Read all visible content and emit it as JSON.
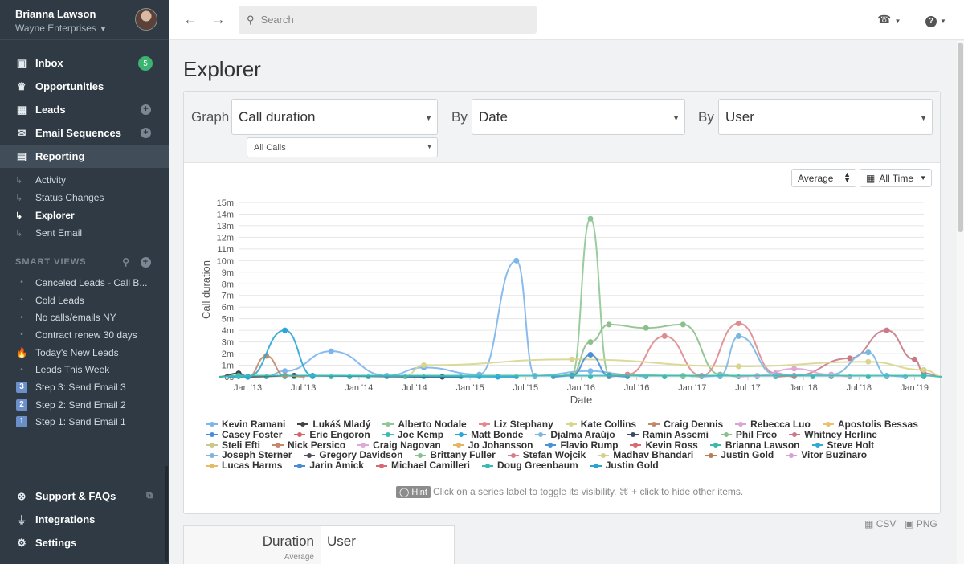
{
  "user": {
    "name": "Brianna Lawson",
    "org": "Wayne Enterprises"
  },
  "nav": [
    {
      "label": "Inbox",
      "icon": "inbox-icon",
      "badge": "5"
    },
    {
      "label": "Opportunities",
      "icon": "trophy-icon"
    },
    {
      "label": "Leads",
      "icon": "building-icon",
      "plus": true
    },
    {
      "label": "Email Sequences",
      "icon": "envelope-icon",
      "plus": true
    },
    {
      "label": "Reporting",
      "icon": "chart-icon",
      "active": true
    }
  ],
  "reporting_sub": [
    "Activity",
    "Status Changes",
    "Explorer",
    "Sent Email"
  ],
  "smart_views": {
    "title": "SMART VIEWS",
    "items": [
      {
        "label": "Canceled Leads - Call B...",
        "mark": "dot"
      },
      {
        "label": "Cold Leads",
        "mark": "dot"
      },
      {
        "label": "No calls/emails NY",
        "mark": "dot"
      },
      {
        "label": "Contract renew 30 days",
        "mark": "dot"
      },
      {
        "label": "Today's New Leads",
        "mark": "fire"
      },
      {
        "label": "Leads This Week",
        "mark": "dot"
      },
      {
        "label": "Step 3: Send Email 3",
        "mark": "3"
      },
      {
        "label": "Step 2: Send Email 2",
        "mark": "2"
      },
      {
        "label": "Step 1: Send Email 1",
        "mark": "1"
      }
    ]
  },
  "bottom_nav": [
    {
      "label": "Support & FAQs",
      "icon": "lifebuoy-icon"
    },
    {
      "label": "Integrations",
      "icon": "plug-icon"
    },
    {
      "label": "Settings",
      "icon": "gear-icon"
    }
  ],
  "search": {
    "placeholder": "Search"
  },
  "page": {
    "title": "Explorer"
  },
  "controls": {
    "graph_label": "Graph",
    "graph_value": "Call duration",
    "filter_value": "All Calls",
    "by1_label": "By",
    "by1_value": "Date",
    "by2_label": "By",
    "by2_value": "User",
    "aggregate": "Average",
    "range": "All Time"
  },
  "hint": {
    "tag": "Hint",
    "text": "Click on a series label to toggle its visibility. ⌘ + click to hide other items."
  },
  "exports": {
    "csv": "CSV",
    "png": "PNG"
  },
  "table": {
    "col1": "Duration",
    "col1_sub": "Average",
    "col2": "User"
  },
  "chart_data": {
    "type": "line",
    "xlabel": "Date",
    "ylabel": "Call duration",
    "y_ticks": [
      "0s",
      "1m",
      "2m",
      "3m",
      "4m",
      "5m",
      "6m",
      "7m",
      "8m",
      "9m",
      "10m",
      "11m",
      "12m",
      "13m",
      "14m",
      "15m"
    ],
    "ylim": [
      0,
      15
    ],
    "y_unit": "minutes",
    "x_ticks": [
      "Jan '13",
      "Jul '13",
      "Jan '14",
      "Jul '14",
      "Jan '15",
      "Jul '15",
      "Jan '16",
      "Jul '16",
      "Jan '17",
      "Jul '17",
      "Jan '18",
      "Jul '18",
      "Jan '19"
    ],
    "x": [
      "2012-12",
      "2013-01",
      "2013-03",
      "2013-05",
      "2013-06",
      "2013-08",
      "2013-10",
      "2013-12",
      "2014-02",
      "2014-04",
      "2014-06",
      "2014-08",
      "2014-10",
      "2014-12",
      "2015-02",
      "2015-04",
      "2015-06",
      "2015-08",
      "2015-10",
      "2015-12",
      "2016-02",
      "2016-04",
      "2016-06",
      "2016-08",
      "2016-10",
      "2016-12",
      "2017-02",
      "2017-04",
      "2017-06",
      "2017-08",
      "2017-10",
      "2017-12",
      "2018-02",
      "2018-04",
      "2018-06",
      "2018-08",
      "2018-10",
      "2018-12",
      "2019-02"
    ],
    "series": [
      {
        "name": "Kevin Ramani",
        "color": "#7cb5ec"
      },
      {
        "name": "Lukáš Mladý",
        "color": "#434348"
      },
      {
        "name": "Alberto Nodale",
        "color": "#90c695"
      },
      {
        "name": "Liz Stephany",
        "color": "#e08a8f"
      },
      {
        "name": "Kate Collins",
        "color": "#d9d58d"
      },
      {
        "name": "Craig Dennis",
        "color": "#c08a68"
      },
      {
        "name": "Rebecca Luo",
        "color": "#d9a3d6"
      },
      {
        "name": "Apostolis Bessas",
        "color": "#e8c16a"
      },
      {
        "name": "Casey Foster",
        "color": "#4a8ed6"
      },
      {
        "name": "Eric Engoron",
        "color": "#d6646a"
      },
      {
        "name": "Joe Kemp",
        "color": "#3cbcb4"
      },
      {
        "name": "Matt Bonde",
        "color": "#2ca6d8"
      },
      {
        "name": "Djalma Araújo",
        "color": "#7ab7e3"
      },
      {
        "name": "Ramin Assemi",
        "color": "#3f4a5e"
      },
      {
        "name": "Phil Freo",
        "color": "#8cc08a"
      },
      {
        "name": "Whitney Herline",
        "color": "#c97a86"
      },
      {
        "name": "Steli Efti",
        "color": "#c9c98a"
      },
      {
        "name": "Nick Persico",
        "color": "#c7876a"
      },
      {
        "name": "Craig Nagovan",
        "color": "#e0a8d8"
      },
      {
        "name": "Jo Johansson",
        "color": "#e5b563"
      },
      {
        "name": "Flavio Rump",
        "color": "#4b93d9"
      },
      {
        "name": "Kevin Ross",
        "color": "#d96a72"
      },
      {
        "name": "Brianna Lawson",
        "color": "#3cb8ad"
      },
      {
        "name": "Steve Holt",
        "color": "#33a9d6"
      },
      {
        "name": "Joseph Sterner",
        "color": "#82b3e0"
      },
      {
        "name": "Gregory Davidson",
        "color": "#4b4f5c"
      },
      {
        "name": "Brittany Fuller",
        "color": "#86c08a"
      },
      {
        "name": "Stefan Wojcik",
        "color": "#d48088"
      },
      {
        "name": "Madhav Bhandari",
        "color": "#d4d08c"
      },
      {
        "name": "Justin Gold",
        "color": "#b87c58"
      },
      {
        "name": "Vitor Buzinaro",
        "color": "#d9a0d6"
      },
      {
        "name": "Lucas Harms",
        "color": "#e5bc66"
      },
      {
        "name": "Jarin Amick",
        "color": "#4a8bd4"
      },
      {
        "name": "Michael Camilleri",
        "color": "#d66a72"
      },
      {
        "name": "Doug Greenbaum",
        "color": "#3bbab0"
      },
      {
        "name": "Justin Gold",
        "color": "#2aa4d6"
      }
    ],
    "plotted": [
      {
        "name": "Kevin Ramani",
        "color": "#7cb5ec",
        "points": [
          [
            "2013-05",
            0.5
          ],
          [
            "2013-10",
            2.2
          ],
          [
            "2014-04",
            0.1
          ],
          [
            "2014-08",
            0.8
          ],
          [
            "2015-02",
            0.2
          ],
          [
            "2015-06",
            10.0
          ],
          [
            "2015-08",
            0.1
          ],
          [
            "2016-02",
            0.5
          ],
          [
            "2016-06",
            0.2
          ]
        ]
      },
      {
        "name": "Lukáš Mladý",
        "color": "#434348",
        "points": [
          [
            "2012-12",
            0.3
          ],
          [
            "2013-01",
            0.0
          ],
          [
            "2013-06",
            0.1
          ],
          [
            "2014-10",
            0.0
          ]
        ]
      },
      {
        "name": "Alberto Nodale",
        "color": "#90c695",
        "points": [
          [
            "2015-12",
            0.2
          ],
          [
            "2016-02",
            13.6
          ],
          [
            "2016-04",
            0.2
          ],
          [
            "2016-12",
            0.1
          ]
        ]
      },
      {
        "name": "Phil Freo",
        "color": "#8cc08a",
        "points": [
          [
            "2016-02",
            3.0
          ],
          [
            "2016-04",
            4.5
          ],
          [
            "2016-08",
            4.2
          ],
          [
            "2016-12",
            4.5
          ],
          [
            "2017-04",
            0.2
          ]
        ]
      },
      {
        "name": "Liz Stephany",
        "color": "#e08a8f",
        "points": [
          [
            "2016-06",
            0.2
          ],
          [
            "2016-10",
            3.5
          ],
          [
            "2017-02",
            0.1
          ],
          [
            "2017-06",
            4.6
          ],
          [
            "2017-10",
            0.3
          ]
        ]
      },
      {
        "name": "Whitney Herline",
        "color": "#c97a86",
        "points": [
          [
            "2017-12",
            0.1
          ],
          [
            "2018-06",
            1.6
          ],
          [
            "2018-10",
            4.0
          ],
          [
            "2019-01",
            1.5
          ],
          [
            "2019-02",
            0.3
          ]
        ]
      },
      {
        "name": "Kate Collins",
        "color": "#d9d58d",
        "points": [
          [
            "2014-08",
            1.0
          ],
          [
            "2015-12",
            1.5
          ],
          [
            "2017-06",
            0.9
          ],
          [
            "2018-08",
            1.3
          ],
          [
            "2019-02",
            0.6
          ]
        ]
      },
      {
        "name": "Craig Dennis",
        "color": "#c08a68",
        "points": [
          [
            "2013-01",
            0.0
          ],
          [
            "2013-03",
            1.8
          ],
          [
            "2013-05",
            0.1
          ]
        ]
      },
      {
        "name": "Matt Bonde",
        "color": "#2ca6d8",
        "points": [
          [
            "2013-01",
            0.0
          ],
          [
            "2013-05",
            4.0
          ],
          [
            "2013-08",
            0.1
          ],
          [
            "2015-04",
            0.0
          ]
        ]
      },
      {
        "name": "Djalma Araújo",
        "color": "#7ab7e3",
        "points": [
          [
            "2017-04",
            0.1
          ],
          [
            "2017-06",
            3.5
          ],
          [
            "2017-10",
            0.2
          ],
          [
            "2018-04",
            0.2
          ],
          [
            "2018-08",
            2.1
          ],
          [
            "2018-10",
            0.1
          ]
        ]
      },
      {
        "name": "Casey Foster",
        "color": "#4a8ed6",
        "points": [
          [
            "2015-12",
            0.1
          ],
          [
            "2016-02",
            1.9
          ],
          [
            "2016-04",
            0.1
          ]
        ]
      },
      {
        "name": "Craig Nagovan",
        "color": "#e0a8d8",
        "points": [
          [
            "2017-08",
            0.1
          ],
          [
            "2017-12",
            0.7
          ],
          [
            "2018-04",
            0.2
          ]
        ]
      },
      {
        "name": "Joe Kemp",
        "color": "#3cbcb4",
        "points": [
          [
            "2012-12",
            0.1
          ],
          [
            "2019-02",
            0.1
          ]
        ]
      }
    ]
  }
}
